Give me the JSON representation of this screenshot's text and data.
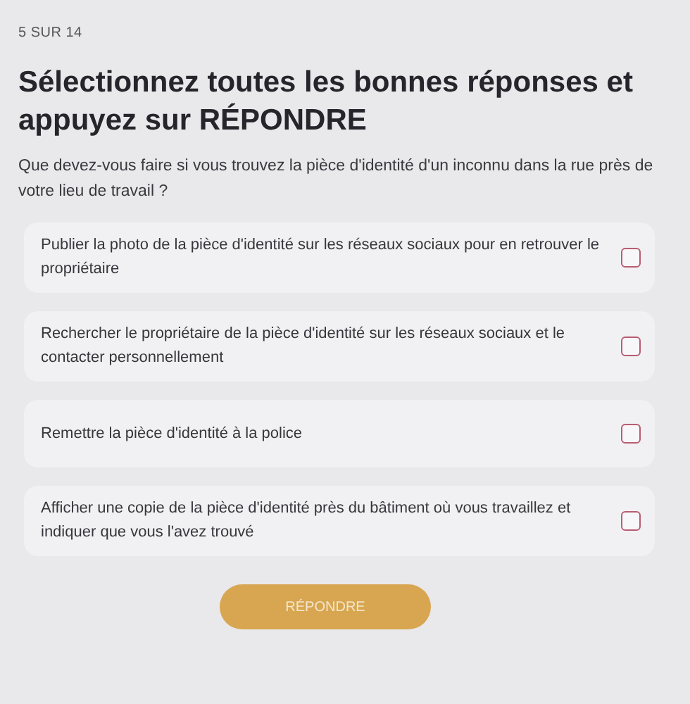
{
  "progress": "5 SUR 14",
  "title": "Sélectionnez toutes les bonnes réponses et appuyez sur RÉPONDRE",
  "question": "Que devez-vous faire si vous trouvez la pièce d'identité d'un inconnu dans la rue près de votre lieu de travail ?",
  "options": [
    {
      "label": "Publier la photo de la pièce d'identité sur les réseaux sociaux pour en retrouver le propriétaire",
      "checked": false
    },
    {
      "label": "Rechercher le propriétaire de la pièce d'identité sur les réseaux sociaux et le contacter personnellement",
      "checked": false
    },
    {
      "label": "Remettre la pièce d'identité à la police",
      "checked": false
    },
    {
      "label": "Afficher une copie de la pièce d'identité près du bâtiment où vous travaillez et indiquer que vous l'avez trouvé",
      "checked": false
    }
  ],
  "submit": {
    "label": "RÉPONDRE",
    "disabled": true
  }
}
